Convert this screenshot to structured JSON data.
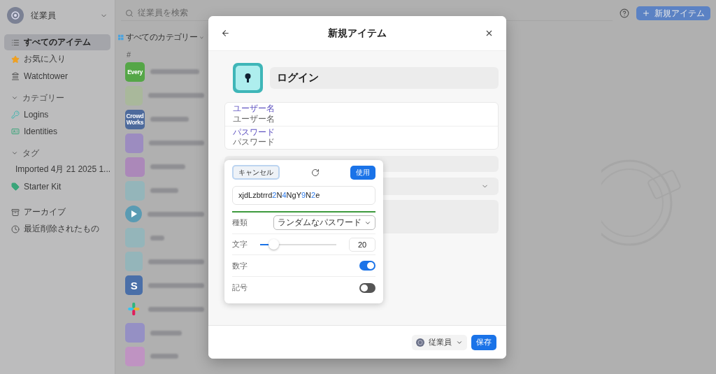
{
  "sidebar": {
    "account": "従業員",
    "items": [
      {
        "label": "すべてのアイテム",
        "kind": "list",
        "selected": true
      },
      {
        "label": "お気に入り",
        "kind": "star",
        "selected": false
      },
      {
        "label": "Watchtower",
        "kind": "tower",
        "selected": false
      }
    ],
    "sections": [
      {
        "title": "カテゴリー",
        "expanded": true,
        "items": [
          {
            "label": "Logins",
            "kind": "login",
            "selected": false
          },
          {
            "label": "Identities",
            "kind": "id",
            "selected": false
          }
        ]
      },
      {
        "title": "タグ",
        "expanded": true,
        "items": [
          {
            "label": "Imported 4月 21 2025 1...",
            "kind": "tag",
            "selected": false
          },
          {
            "label": "Starter Kit",
            "kind": "tag",
            "selected": false
          }
        ]
      }
    ],
    "footer_items": [
      {
        "label": "アーカイブ",
        "kind": "archive",
        "selected": false
      },
      {
        "label": "最近削除されたもの",
        "kind": "trash",
        "selected": false
      }
    ]
  },
  "topbar": {
    "search": {
      "placeholder": "従業員を検索"
    },
    "new_button": "新規アイテム"
  },
  "list": {
    "filter": "すべてのカテゴリー",
    "group": "#",
    "items": [
      {
        "kind": "text",
        "color": "#55a647",
        "text": "Every"
      },
      {
        "kind": "plain",
        "color": "#a9b89b"
      },
      {
        "kind": "text",
        "color": "#4d6a9c",
        "text": "Crowd Works"
      },
      {
        "kind": "plain",
        "color": "#9c8cc0"
      },
      {
        "kind": "plain",
        "color": "#ab88b9"
      },
      {
        "kind": "plain",
        "color": "#94b5ba"
      },
      {
        "kind": "play",
        "color": "#5a9bb3"
      },
      {
        "kind": "plain",
        "color": "#94b5ba"
      },
      {
        "kind": "plain",
        "color": "#94b5ba"
      },
      {
        "kind": "text",
        "color": "#4a6fa8",
        "text": "S"
      },
      {
        "kind": "slack",
        "color": "#e01e5a"
      },
      {
        "kind": "plain",
        "color": "#9590c4"
      },
      {
        "kind": "plain",
        "color": "#bf93c2"
      }
    ]
  },
  "dialog": {
    "title": "新規アイテム",
    "item_title": "ログイン",
    "fields": [
      {
        "label": "ユーザー名",
        "placeholder": "ユーザー名"
      },
      {
        "label": "パスワード",
        "placeholder": "パスワード"
      }
    ],
    "vault": "従業員",
    "save": "保存"
  },
  "generator": {
    "cancel": "キャンセル",
    "use": "使用",
    "password": "xjdLzbtrrd2N4NgY9N2e",
    "options": [
      {
        "kind": "select",
        "label": "種類",
        "value": "ランダムなパスワード"
      },
      {
        "kind": "slider",
        "label": "文字",
        "level": 0.17,
        "value": "20"
      },
      {
        "kind": "toggle",
        "label": "数字",
        "on": true
      },
      {
        "kind": "toggle",
        "label": "記号",
        "on": false
      }
    ]
  }
}
